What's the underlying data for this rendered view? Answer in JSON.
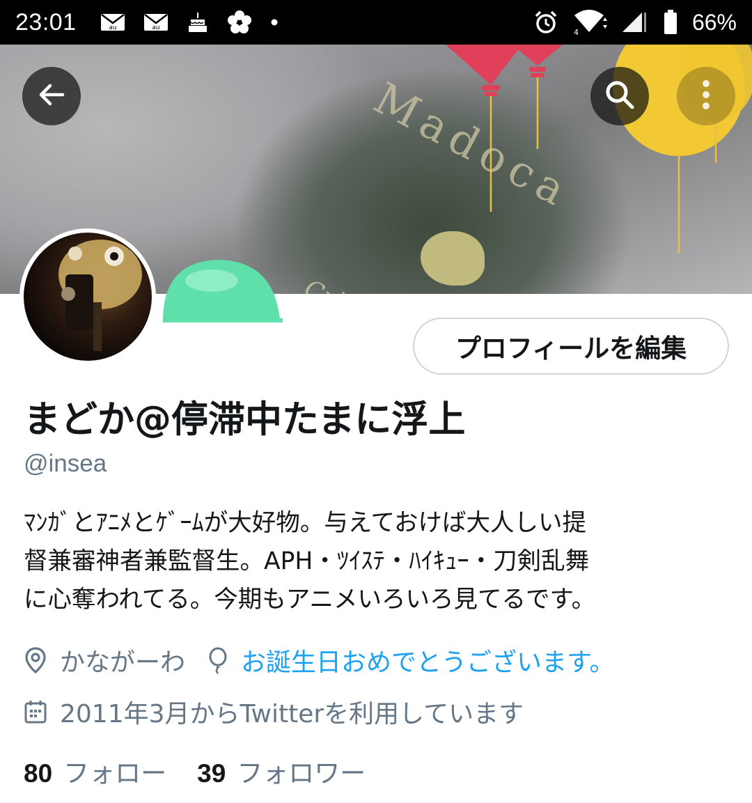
{
  "status_bar": {
    "time": "23:01",
    "battery_percent": "66%",
    "left_icons": [
      "mail-au-icon",
      "mail-au-icon",
      "birthday-cake-icon",
      "flower-icon",
      "dot-icon"
    ],
    "right_icons": [
      "alarm-icon",
      "wifi-4g-icon",
      "signal-icon",
      "battery-icon"
    ]
  },
  "header": {
    "back_icon": "arrow-left-icon",
    "search_icon": "search-icon",
    "more_icon": "more-vertical-icon"
  },
  "banner": {
    "text_main": "Madoca",
    "text_sub": "Crème"
  },
  "profile": {
    "edit_button_label": "プロフィールを編集",
    "display_name": "まどか@停滞中たまに浮上",
    "handle": "@insea",
    "bio_lines": [
      "ﾏﾝｶﾞとｱﾆﾒとｹﾞｰﾑが大好物。与えておけば大人しい提",
      "督兼審神者兼監督生。APH・ﾂｲｽﾃ・ﾊｲｷｭｰ・刀剣乱舞",
      "に心奪われてる。今期もアニメいろいろ見てるです。"
    ],
    "location": "かながーわ",
    "birthday_text": "お誕生日おめでとうございます。",
    "joined": "2011年3月からTwitterを利用しています",
    "following_count": "80",
    "following_label": "フォロー",
    "followers_count": "39",
    "followers_label": "フォロワー"
  },
  "colors": {
    "accent": "#1da1f2",
    "secondary_text": "#657786",
    "primary_text": "#14171a",
    "balloon_red": "#e0405a",
    "balloon_yellow": "#f2c935",
    "bubble_green": "#5fe0aa"
  }
}
